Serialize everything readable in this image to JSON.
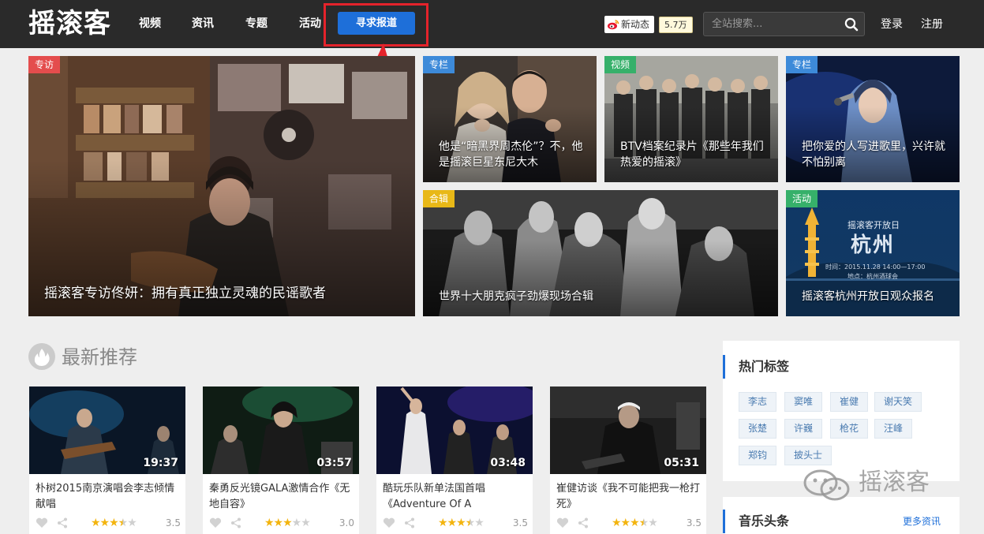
{
  "header": {
    "logo": "摇滚客",
    "nav": [
      "视频",
      "资讯",
      "专题",
      "活动"
    ],
    "cta_label": "寻求报道",
    "weibo_label": "新动态",
    "follow_count": "5.7万",
    "search_placeholder": "全站搜索...",
    "login": "登录",
    "register": "注册"
  },
  "hero": {
    "main": {
      "badge": "专访",
      "caption": "摇滚客专访佟妍：拥有真正独立灵魂的民谣歌者"
    },
    "tile1": {
      "badge": "专栏",
      "caption": "他是“暗黑界周杰伦”？不，他是摇滚巨星东尼大木"
    },
    "tile2": {
      "badge": "视频",
      "caption": "BTV档案纪录片《那些年我们热爱的摇滚》"
    },
    "tile3": {
      "badge": "专栏",
      "caption": "把你爱的人写进歌里，兴许就不怕别离"
    },
    "tile4": {
      "badge": "合辑",
      "caption": "世界十大朋克疯子劲爆现场合辑"
    },
    "tile5": {
      "badge": "活动",
      "caption": "摇滚客杭州开放日观众报名",
      "poster_title": "摇滚客开放日",
      "poster_city": "杭州",
      "poster_time": "时间：2015.11.28 14:00—17:00",
      "poster_place": "地点：杭州酒球会"
    }
  },
  "latest": {
    "title": "最新推荐",
    "cards": [
      {
        "duration": "19:37",
        "title": "朴树2015南京演唱会李志倾情献唱",
        "rating": 3.5,
        "score": "3.5"
      },
      {
        "duration": "03:57",
        "title": "秦勇反光镜GALA激情合作《无地自容》",
        "rating": 3.0,
        "score": "3.0"
      },
      {
        "duration": "03:48",
        "title": "酷玩乐队新单法国首唱《Adventure Of A",
        "rating": 3.5,
        "score": "3.5"
      },
      {
        "duration": "05:31",
        "title": "崔健访谈《我不可能把我一枪打死》",
        "rating": 3.5,
        "score": "3.5"
      }
    ]
  },
  "sidebar": {
    "hot_tags_title": "热门标签",
    "tags": [
      "李志",
      "窦唯",
      "崔健",
      "谢天笑",
      "张楚",
      "许巍",
      "枪花",
      "汪峰",
      "郑钧",
      "披头士"
    ],
    "music_news_title": "音乐头条",
    "more_news": "更多资讯"
  },
  "watermark": "摇滚客",
  "colors": {
    "topbar": "#2a2a2a",
    "accent_blue": "#1e6fd9",
    "highlight_red": "#e5232b",
    "badge_red": "#e44d4d",
    "badge_blue": "#3d8ad9",
    "badge_green": "#36b06a",
    "badge_yellow": "#e8b817",
    "star": "#f3b40e"
  }
}
